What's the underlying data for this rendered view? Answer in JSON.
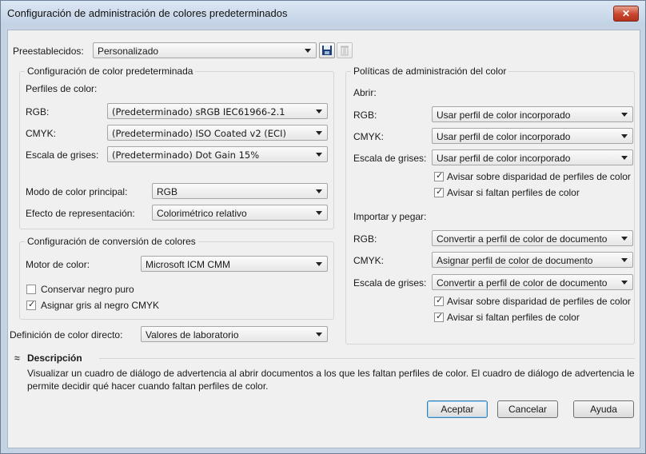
{
  "window": {
    "title": "Configuración de administración de colores predeterminados",
    "close_glyph": "✕"
  },
  "presets": {
    "label": "Preestablecidos:",
    "value": "Personalizado"
  },
  "default_config": {
    "title": "Configuración de color predeterminada",
    "profiles_label": "Perfiles de color:",
    "rgb_label": "RGB:",
    "rgb_value": "(Predeterminado) sRGB IEC61966-2.1",
    "cmyk_label": "CMYK:",
    "cmyk_value": "(Predeterminado) ISO Coated v2 (ECI)",
    "gray_label": "Escala de grises:",
    "gray_value": "(Predeterminado) Dot Gain 15%",
    "primary_mode_label": "Modo de color principal:",
    "primary_mode_value": "RGB",
    "render_label": "Efecto de representación:",
    "render_value": "Colorimétrico relativo"
  },
  "conversion": {
    "title": "Configuración de conversión de colores",
    "engine_label": "Motor de color:",
    "engine_value": "Microsoft ICM CMM",
    "pure_black_label": "Conservar negro puro",
    "pure_black_checked": false,
    "gray_black_label": "Asignar gris al negro CMYK",
    "gray_black_checked": true
  },
  "spot": {
    "label": "Definición de color directo:",
    "value": "Valores de laboratorio"
  },
  "policies": {
    "title": "Políticas de administración del color",
    "open": {
      "label": "Abrir:",
      "rgb_label": "RGB:",
      "rgb_value": "Usar perfil de color incorporado",
      "cmyk_label": "CMYK:",
      "cmyk_value": "Usar perfil de color incorporado",
      "gray_label": "Escala de grises:",
      "gray_value": "Usar perfil de color incorporado",
      "warn_mismatch": "Avisar sobre disparidad de perfiles de color",
      "warn_missing": "Avisar si faltan perfiles de color"
    },
    "import": {
      "label": "Importar y pegar:",
      "rgb_label": "RGB:",
      "rgb_value": "Convertir a perfil de color de documento",
      "cmyk_label": "CMYK:",
      "cmyk_value": "Asignar perfil de color de documento",
      "gray_label": "Escala de grises:",
      "gray_value": "Convertir a perfil de color de documento",
      "warn_mismatch": "Avisar sobre disparidad de perfiles de color",
      "warn_missing": "Avisar si faltan perfiles de color"
    }
  },
  "description": {
    "toggle_glyph": "≈",
    "title": "Descripción",
    "line1": "Visualizar un cuadro de diálogo de advertencia al abrir documentos a los que les faltan perfiles de color. El cuadro de diálogo de advertencia le",
    "line2": "permite decidir qué hacer cuando faltan perfiles de color."
  },
  "buttons": {
    "accept": "Aceptar",
    "cancel": "Cancelar",
    "help": "Ayuda"
  },
  "icons": {
    "save": "save-icon",
    "delete": "trash-icon",
    "check": "✓"
  }
}
